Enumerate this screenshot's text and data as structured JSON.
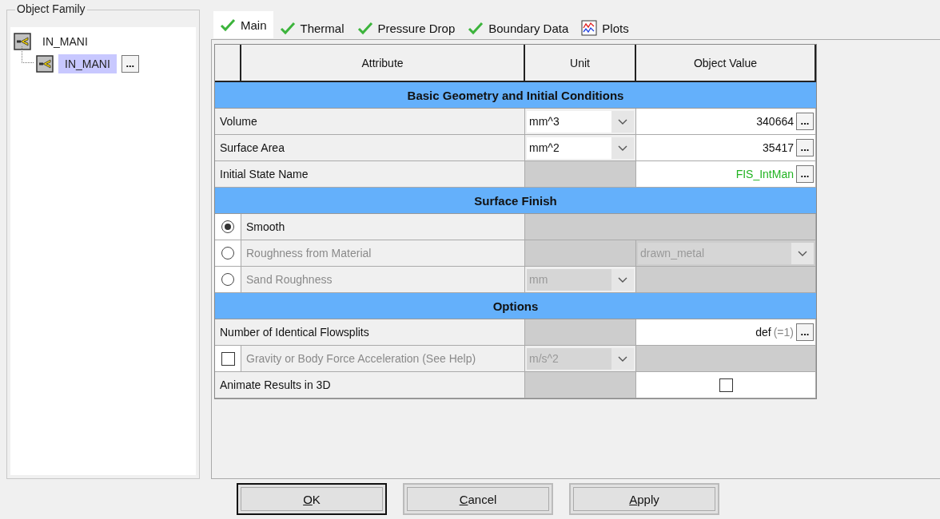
{
  "object_family": {
    "title": "Object Family",
    "items": [
      {
        "label": "IN_MANI",
        "selected": false,
        "children": [
          {
            "label": "IN_MANI",
            "selected": true,
            "button": "..."
          }
        ]
      }
    ]
  },
  "tabs": [
    {
      "label": "Main",
      "kind": "check",
      "selected": true
    },
    {
      "label": "Thermal",
      "kind": "check",
      "selected": false
    },
    {
      "label": "Pressure Drop",
      "kind": "check",
      "selected": false
    },
    {
      "label": "Boundary Data",
      "kind": "check",
      "selected": false
    },
    {
      "label": "Plots",
      "kind": "plot",
      "selected": false
    }
  ],
  "table": {
    "columns": [
      "Attribute",
      "Unit",
      "Object Value"
    ],
    "rows": [
      {
        "kind": "section",
        "title": "Basic Geometry and Initial Conditions"
      },
      {
        "kind": "field",
        "label": "Volume",
        "disabled": false,
        "unit": {
          "text": "mm^3",
          "disabled": false
        },
        "value": {
          "kind": "text",
          "text": "340664",
          "button": "..."
        }
      },
      {
        "kind": "field",
        "label": "Surface Area",
        "disabled": false,
        "unit": {
          "text": "mm^2",
          "disabled": false
        },
        "value": {
          "kind": "text",
          "text": "35417",
          "button": "..."
        }
      },
      {
        "kind": "field",
        "label": "Initial State Name",
        "disabled": false,
        "value": {
          "kind": "text",
          "text": "FIS_IntMan",
          "color": "#22b422",
          "button": "..."
        }
      },
      {
        "kind": "section",
        "title": "Surface Finish"
      },
      {
        "kind": "radio",
        "label": "Smooth",
        "selected": true,
        "disabled": false,
        "value": {
          "kind": "blank"
        }
      },
      {
        "kind": "radio",
        "label": "Roughness from Material",
        "selected": false,
        "disabled": true,
        "value": {
          "kind": "dropdown",
          "text": "drawn_metal",
          "disabled": true
        }
      },
      {
        "kind": "radio",
        "label": "Sand Roughness",
        "selected": false,
        "disabled": true,
        "unit": {
          "text": "mm",
          "disabled": true
        },
        "value": {
          "kind": "blank"
        }
      },
      {
        "kind": "section",
        "title": "Options"
      },
      {
        "kind": "field",
        "label": "Number of Identical Flowsplits",
        "disabled": false,
        "value": {
          "kind": "text",
          "text": "def",
          "note": "(=1)",
          "button": "..."
        }
      },
      {
        "kind": "checkbox",
        "label": "Gravity or Body Force Acceleration (See Help)",
        "checked": false,
        "disabled": true,
        "unit": {
          "text": "m/s^2",
          "disabled": true
        },
        "value": {
          "kind": "blank"
        }
      },
      {
        "kind": "field",
        "label": "Animate Results in 3D",
        "disabled": false,
        "value": {
          "kind": "checkbox",
          "checked": false
        }
      }
    ]
  },
  "buttons": [
    {
      "label": "OK",
      "default": true
    },
    {
      "label": "Cancel",
      "default": false
    },
    {
      "label": "Apply",
      "default": false
    }
  ]
}
